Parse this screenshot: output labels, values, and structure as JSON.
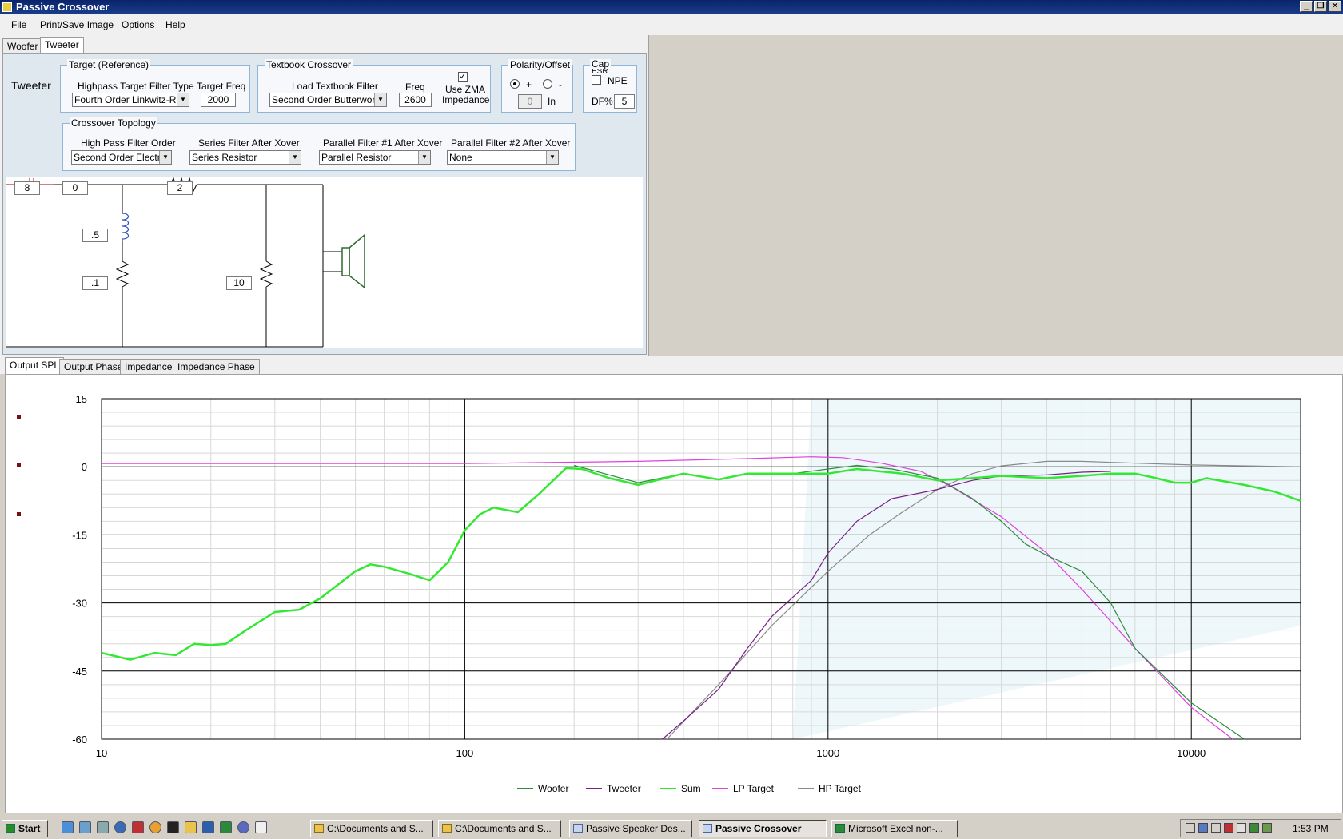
{
  "window": {
    "title": "Passive Crossover"
  },
  "menu": [
    "File",
    "Print/Save Image",
    "Options",
    "Help"
  ],
  "driver_tabs": [
    "Woofer",
    "Tweeter"
  ],
  "active_driver": "Tweeter",
  "target": {
    "group_label": "Target (Reference)",
    "filter_type_label": "Highpass Target Filter Type",
    "filter_type_value": "Fourth Order Linkwitz-Riley",
    "freq_label": "Target Freq",
    "freq_value": "2000"
  },
  "textbook": {
    "group_label": "Textbook Crossover",
    "load_label": "Load Textbook Filter",
    "load_value": "Second Order Butterworth",
    "freq_label": "Freq",
    "freq_value": "2600",
    "zma_label_1": "Use ZMA",
    "zma_label_2": "Impedance",
    "zma_checked": "✓"
  },
  "polarity": {
    "group_label": "Polarity/Offset",
    "plus": "+",
    "minus": "-",
    "offset_value": "0",
    "offset_unit": "In"
  },
  "cap": {
    "group_label": "Cap",
    "group_sub": "ESR",
    "npe_label": "NPE",
    "df_label": "DF%",
    "df_value": "5"
  },
  "topology": {
    "group_label": "Crossover Topology",
    "hp_label": "High Pass Filter Order",
    "hp_value": "Second Order Electric",
    "series_label": "Series Filter After Xover",
    "series_value": "Series Resistor",
    "par1_label": "Parallel Filter #1 After Xover",
    "par1_value": "Parallel Resistor",
    "par2_label": "Parallel Filter #2 After Xover",
    "par2_value": "None"
  },
  "schematic": {
    "cap_value": "8",
    "cap2_value": "0",
    "series_res_value": "2",
    "inductor_value": ".5",
    "inductor_res_value": ".1",
    "par_res_value": "10"
  },
  "plot_tabs": [
    "Output SPL",
    "Output Phase",
    "Impedance",
    "Impedance Phase"
  ],
  "colors": {
    "woofer": "#2e8b3e",
    "tweeter": "#7a1f8a",
    "sum": "#33e833",
    "lp_target": "#e040e0",
    "hp_target": "#8a8a8a"
  },
  "chart_data": {
    "type": "line",
    "title": "",
    "xlabel": "",
    "ylabel": "",
    "x_scale": "log",
    "xlim": [
      10,
      20000
    ],
    "ylim": [
      -60,
      15
    ],
    "x_ticks": [
      10,
      100,
      1000,
      10000
    ],
    "y_ticks": [
      15,
      0,
      -15,
      -30,
      -45,
      -60
    ],
    "grid": true,
    "legend_position": "bottom",
    "series": [
      {
        "name": "Woofer",
        "color": "#2e8b3e",
        "points": [
          [
            200,
            0.3
          ],
          [
            300,
            -3.5
          ],
          [
            400,
            -1.5
          ],
          [
            500,
            -2.8
          ],
          [
            600,
            -1.5
          ],
          [
            800,
            -1.5
          ],
          [
            1000,
            -0.5
          ],
          [
            1200,
            0.3
          ],
          [
            1500,
            -0.5
          ],
          [
            2000,
            -2.5
          ],
          [
            2500,
            -7
          ],
          [
            3000,
            -12
          ],
          [
            3500,
            -17
          ],
          [
            4000,
            -19.5
          ],
          [
            5000,
            -23
          ],
          [
            6000,
            -30
          ],
          [
            7000,
            -40
          ],
          [
            10000,
            -52
          ],
          [
            14000,
            -60
          ]
        ]
      },
      {
        "name": "Tweeter",
        "color": "#7a1f8a",
        "points": [
          [
            350,
            -60
          ],
          [
            400,
            -56
          ],
          [
            500,
            -49
          ],
          [
            600,
            -40
          ],
          [
            700,
            -33
          ],
          [
            900,
            -25
          ],
          [
            1000,
            -19
          ],
          [
            1200,
            -12
          ],
          [
            1500,
            -7
          ],
          [
            2000,
            -5
          ],
          [
            2500,
            -3
          ],
          [
            3000,
            -2
          ],
          [
            4000,
            -1.8
          ],
          [
            5000,
            -1.2
          ],
          [
            6000,
            -1
          ]
        ]
      },
      {
        "name": "Sum",
        "color": "#33e833",
        "points": [
          [
            10,
            -41
          ],
          [
            12,
            -42.5
          ],
          [
            14,
            -41
          ],
          [
            16,
            -41.5
          ],
          [
            18,
            -39
          ],
          [
            20,
            -39.3
          ],
          [
            22,
            -39
          ],
          [
            25,
            -36
          ],
          [
            30,
            -32
          ],
          [
            35,
            -31.5
          ],
          [
            40,
            -29
          ],
          [
            50,
            -23
          ],
          [
            55,
            -21.5
          ],
          [
            60,
            -22
          ],
          [
            70,
            -23.5
          ],
          [
            80,
            -25
          ],
          [
            90,
            -21
          ],
          [
            100,
            -14
          ],
          [
            110,
            -10.5
          ],
          [
            120,
            -9
          ],
          [
            140,
            -10
          ],
          [
            160,
            -6
          ],
          [
            190,
            -0.3
          ],
          [
            210,
            -0.5
          ],
          [
            250,
            -2.5
          ],
          [
            300,
            -4
          ],
          [
            400,
            -1.5
          ],
          [
            500,
            -2.8
          ],
          [
            600,
            -1.5
          ],
          [
            800,
            -1.5
          ],
          [
            1000,
            -1.5
          ],
          [
            1200,
            -0.5
          ],
          [
            1600,
            -1.5
          ],
          [
            2000,
            -3
          ],
          [
            2500,
            -2.5
          ],
          [
            3000,
            -2
          ],
          [
            4000,
            -2.5
          ],
          [
            5000,
            -2
          ],
          [
            6000,
            -1.5
          ],
          [
            7000,
            -1.5
          ],
          [
            8000,
            -2.5
          ],
          [
            9000,
            -3.5
          ],
          [
            10000,
            -3.5
          ],
          [
            11000,
            -2.5
          ],
          [
            14000,
            -4
          ],
          [
            17000,
            -5.5
          ],
          [
            20000,
            -7.5
          ]
        ]
      },
      {
        "name": "LP Target",
        "color": "#e040e0",
        "points": [
          [
            10,
            0.7
          ],
          [
            100,
            0.7
          ],
          [
            300,
            1.2
          ],
          [
            600,
            1.8
          ],
          [
            900,
            2.2
          ],
          [
            1100,
            2
          ],
          [
            1400,
            0.8
          ],
          [
            1800,
            -1
          ],
          [
            2200,
            -4.5
          ],
          [
            3000,
            -11
          ],
          [
            4000,
            -19
          ],
          [
            5000,
            -27
          ],
          [
            7000,
            -40
          ],
          [
            10000,
            -53
          ],
          [
            13000,
            -60
          ]
        ]
      },
      {
        "name": "HP Target",
        "color": "#8a8a8a",
        "points": [
          [
            360,
            -60
          ],
          [
            500,
            -48
          ],
          [
            700,
            -35
          ],
          [
            1000,
            -23
          ],
          [
            1300,
            -15
          ],
          [
            1600,
            -10
          ],
          [
            2000,
            -5
          ],
          [
            2500,
            -1.5
          ],
          [
            3000,
            0.2
          ],
          [
            4000,
            1.2
          ],
          [
            5000,
            1.2
          ],
          [
            7000,
            0.8
          ],
          [
            10000,
            0.4
          ],
          [
            20000,
            0
          ]
        ]
      }
    ]
  },
  "taskbar": {
    "start": "Start",
    "items": [
      {
        "label": "C:\\Documents and S..."
      },
      {
        "label": "C:\\Documents and S..."
      },
      {
        "label": "Passive Speaker Des..."
      },
      {
        "label": "Passive Crossover"
      },
      {
        "label": "Microsoft Excel non-..."
      }
    ],
    "time": "1:53 PM"
  }
}
